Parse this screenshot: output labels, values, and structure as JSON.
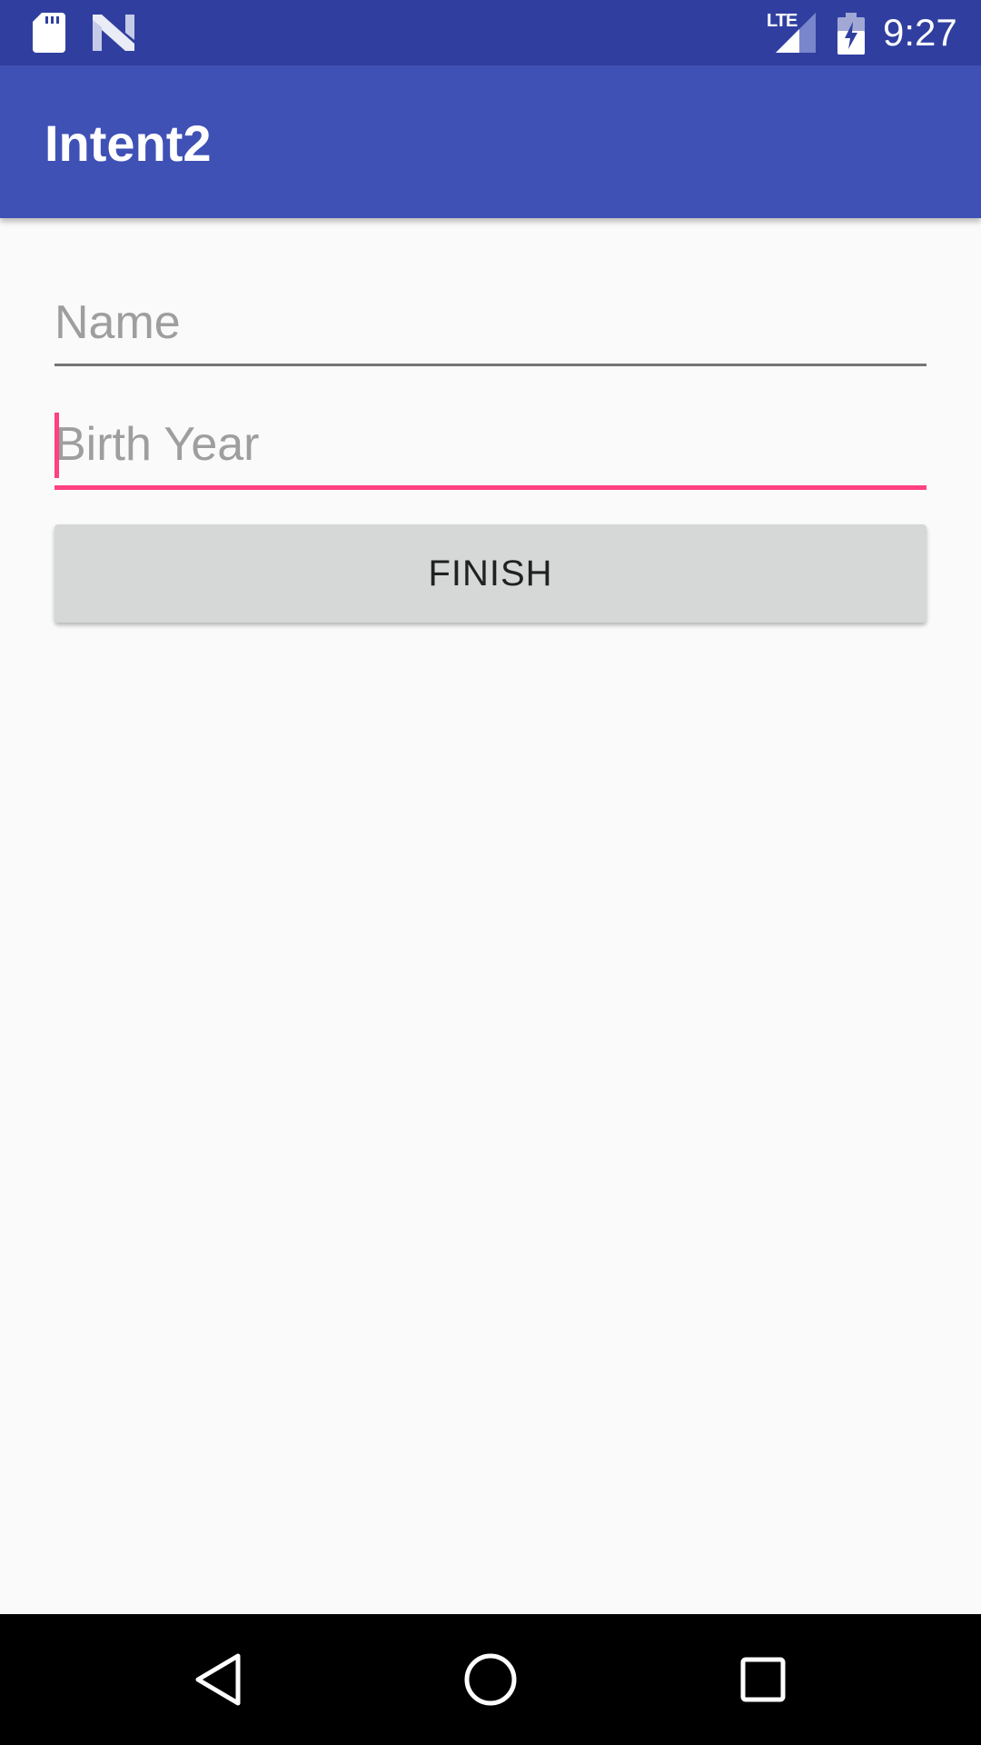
{
  "status_bar": {
    "network_label": "LTE",
    "time": "9:27",
    "icons": [
      "sd-card-icon",
      "n-logo-icon",
      "signal-icon",
      "battery-charging-icon"
    ]
  },
  "app_bar": {
    "title": "Intent2",
    "color": "#3f51b5"
  },
  "form": {
    "name_field": {
      "placeholder": "Name",
      "value": ""
    },
    "birth_year_field": {
      "placeholder": "Birth Year",
      "value": "",
      "focused": true
    },
    "finish_button_label": "FINISH"
  },
  "nav_bar": {
    "icons": [
      "back-icon",
      "home-icon",
      "recents-icon"
    ]
  },
  "colors": {
    "status_bar": "#303f9f",
    "primary": "#3f51b5",
    "accent": "#ff4081",
    "background": "#fafafa",
    "button": "#d6d7d7"
  }
}
